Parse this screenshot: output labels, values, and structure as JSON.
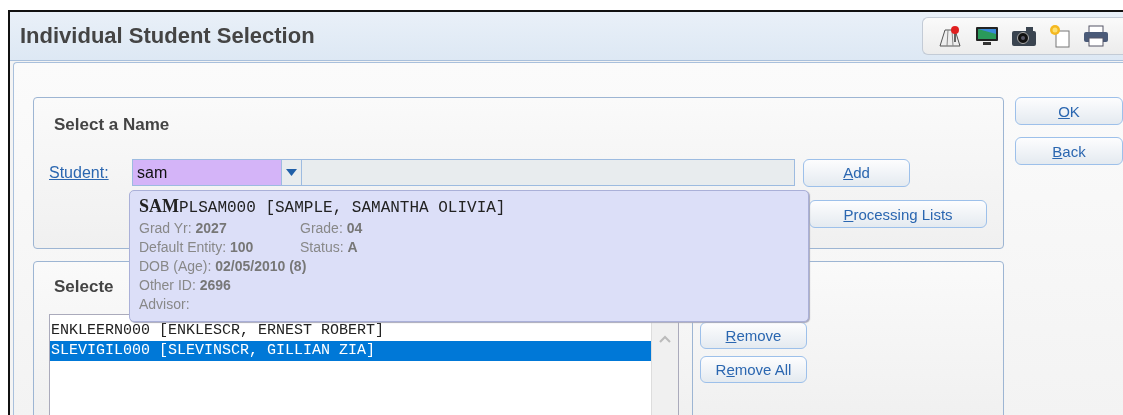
{
  "window": {
    "title": "Individual Student Selection"
  },
  "toolbar": [
    {
      "kind": "map"
    },
    {
      "kind": "monitor"
    },
    {
      "kind": "camera"
    },
    {
      "kind": "new-document"
    },
    {
      "kind": "printer"
    }
  ],
  "select_panel": {
    "heading": "Select a Name",
    "student_label": "Student:",
    "student_value": "sam",
    "add_button": {
      "key": "A",
      "post": "dd"
    },
    "processing_button": {
      "key": "P",
      "post": "rocessing Lists"
    }
  },
  "suggestion": {
    "title": "**SAM**PLSAM000 [SAMPLE, SAMANTHA OLIVIA]",
    "rows": [
      [
        {
          "label": "Grad Yr:",
          "value": "2027"
        },
        {
          "label": "Grade:",
          "value": "04"
        }
      ],
      [
        {
          "label": "Default Entity:",
          "value": "100"
        },
        {
          "label": "Status:",
          "value": "A"
        }
      ],
      [
        {
          "label": "DOB (Age):",
          "value": "02/05/2010 (8)"
        }
      ],
      [
        {
          "label": "Other ID:",
          "value": "2696"
        }
      ],
      [
        {
          "label": "Advisor:"
        }
      ]
    ]
  },
  "selected_panel": {
    "heading": "Selecte",
    "items": [
      {
        "text": "ENKLEERN000 [ENKLESCR, ERNEST ROBERT]",
        "selected": false
      },
      {
        "text": "SLEVIGIL000 [SLEVINSCR, GILLIAN ZIA]",
        "selected": true
      }
    ],
    "remove_button": {
      "key": "R",
      "post": "emove"
    },
    "remove_all_button": {
      "pre": "R",
      "key": "e",
      "post": "move All"
    }
  },
  "side_buttons": [
    {
      "key": "O",
      "post": "K"
    },
    {
      "key": "B",
      "post": "ack"
    }
  ]
}
